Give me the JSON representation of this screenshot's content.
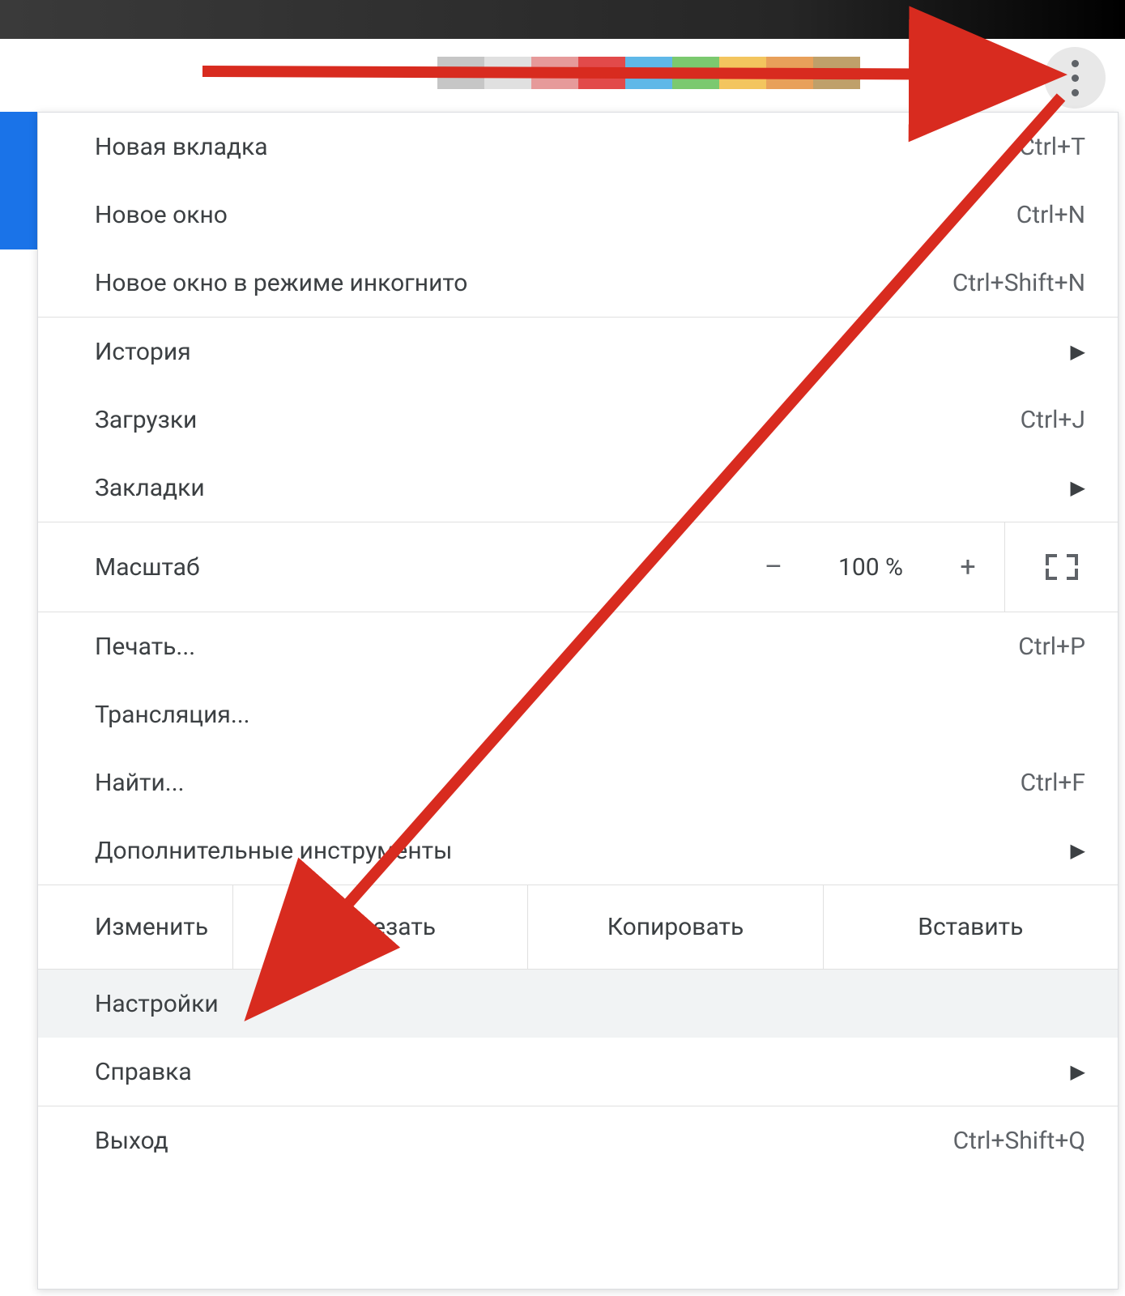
{
  "tab_swatch_colors": [
    "#c6c6c6",
    "#e0e0e0",
    "#e69a9a",
    "#e24a4a",
    "#5fb8e8",
    "#7bc96f",
    "#f3c55e",
    "#e8a05a",
    "#bfa06a"
  ],
  "menu": {
    "new_tab": {
      "label": "Новая вкладка",
      "shortcut": "Ctrl+T"
    },
    "new_window": {
      "label": "Новое окно",
      "shortcut": "Ctrl+N"
    },
    "incognito": {
      "label": "Новое окно в режиме инкогнито",
      "shortcut": "Ctrl+Shift+N"
    },
    "history": {
      "label": "История"
    },
    "downloads": {
      "label": "Загрузки",
      "shortcut": "Ctrl+J"
    },
    "bookmarks": {
      "label": "Закладки"
    },
    "zoom": {
      "label": "Масштаб",
      "value": "100 %",
      "minus": "–",
      "plus": "+"
    },
    "print": {
      "label": "Печать...",
      "shortcut": "Ctrl+P"
    },
    "cast": {
      "label": "Трансляция..."
    },
    "find": {
      "label": "Найти...",
      "shortcut": "Ctrl+F"
    },
    "more_tools": {
      "label": "Дополнительные инструменты"
    },
    "edit": {
      "label": "Изменить",
      "cut": "Вырезать",
      "copy": "Копировать",
      "paste": "Вставить"
    },
    "settings": {
      "label": "Настройки"
    },
    "help": {
      "label": "Справка"
    },
    "exit": {
      "label": "Выход",
      "shortcut": "Ctrl+Shift+Q"
    }
  },
  "colors": {
    "arrow": "#d82b1f",
    "blue": "#1a73e8"
  }
}
